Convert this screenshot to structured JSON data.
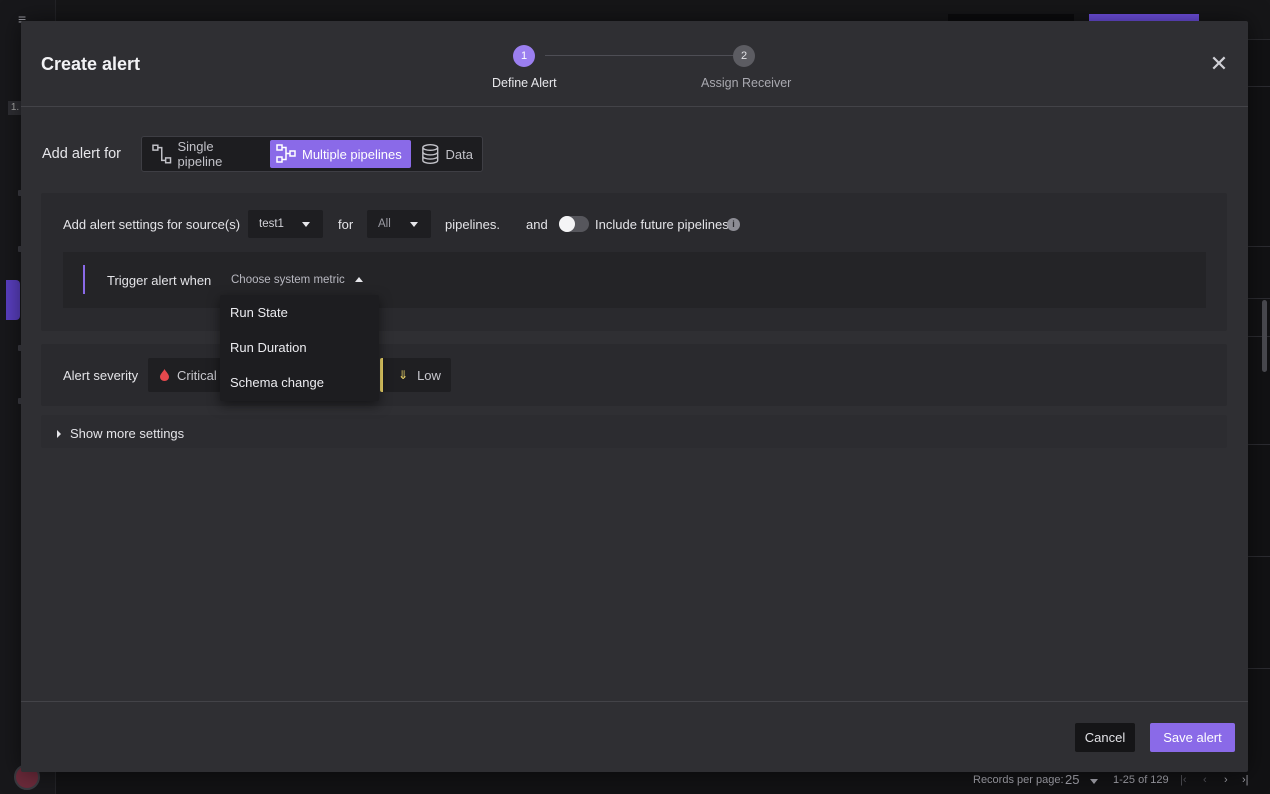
{
  "background": {
    "version_badge": "1.",
    "pager": {
      "records_label": "Records per page:",
      "records_value": "25",
      "range": "1-25 of 129"
    }
  },
  "modal": {
    "title": "Create alert",
    "close_icon": "close-icon",
    "steps": [
      {
        "number": "1",
        "label": "Define Alert",
        "state": "active"
      },
      {
        "number": "2",
        "label": "Assign Receiver",
        "state": "inactive"
      }
    ],
    "add_alert_for": {
      "label": "Add alert for",
      "options": [
        {
          "label": "Single pipeline",
          "icon": "single-pipeline-icon",
          "selected": false
        },
        {
          "label": "Multiple pipelines",
          "icon": "multiple-pipelines-icon",
          "selected": true
        },
        {
          "label": "Data",
          "icon": "database-icon",
          "selected": false
        }
      ]
    },
    "settings": {
      "prefix": "Add alert settings for source(s)",
      "source_value": "test1",
      "for_label": "for",
      "pipelines_value": "All",
      "pipelines_label": "pipelines.",
      "and_label": "and",
      "include_future_label": "Include future pipelines",
      "include_future_on": false
    },
    "trigger": {
      "label": "Trigger alert when",
      "placeholder": "Choose system metric",
      "dropdown_open": true,
      "options": [
        "Run State",
        "Run Duration",
        "Schema change"
      ]
    },
    "severity": {
      "label": "Alert severity",
      "critical": "Critical",
      "low": "Low"
    },
    "show_more": "Show more settings",
    "buttons": {
      "cancel": "Cancel",
      "save": "Save alert"
    }
  },
  "colors": {
    "accent": "#8a6ae8",
    "modal_bg": "#2f2f33",
    "low_severity": "#f0d86a",
    "critical_severity": "#e5484d"
  }
}
